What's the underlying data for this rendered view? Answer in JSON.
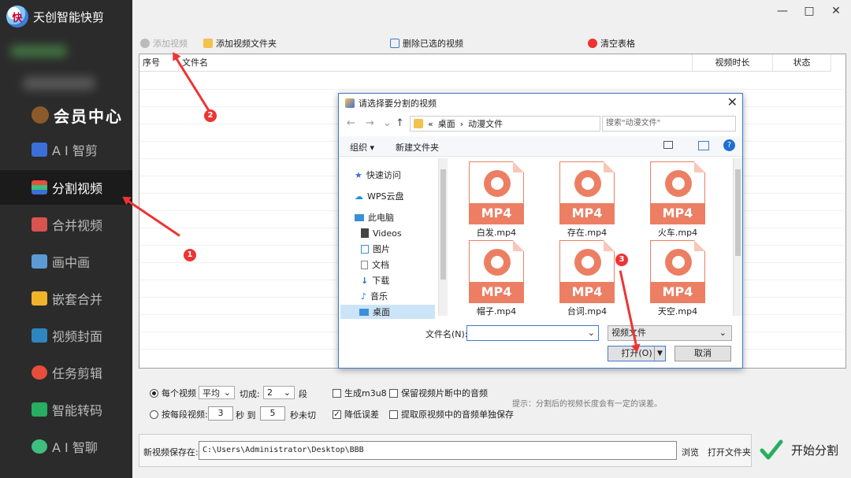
{
  "app": {
    "title": "天创智能快剪",
    "logo_text": "快"
  },
  "window": {
    "minimize": "—",
    "maximize": "□",
    "close": "✕"
  },
  "sidebar": {
    "member": "会员中心",
    "items": [
      {
        "label": "A I 智剪",
        "color": "#3b6fd8"
      },
      {
        "label": "分割视频",
        "color": "#e94d3b",
        "active": true
      },
      {
        "label": "合并视频",
        "color": "#d9534f"
      },
      {
        "label": "画中画",
        "color": "#5b9bd5"
      },
      {
        "label": "嵌套合并",
        "color": "#f0b429"
      },
      {
        "label": "视频封面",
        "color": "#2e86c1"
      },
      {
        "label": "任务剪辑",
        "color": "#e74c3c"
      },
      {
        "label": "智能转码",
        "color": "#27ae60"
      },
      {
        "label": "A I 智聊",
        "color": "#3fbf7f"
      }
    ]
  },
  "toolbar": {
    "add_video": "添加视频",
    "add_folder": "添加视频文件夹",
    "delete_selected": "删除已选的视频",
    "clear_table": "清空表格"
  },
  "table": {
    "columns": [
      "序号",
      "文件名",
      "视频时长",
      "状态"
    ]
  },
  "options": {
    "per_video": "每个视频",
    "mode": "平均",
    "cut_label": "切成:",
    "segments": "2",
    "segment_unit": "段",
    "gen_m3u8": "生成m3u8",
    "keep_audio": "保留视频片断中的音频",
    "by_seconds": "按每段视频:",
    "sec_from": "3",
    "sec_to_label": "秒  到",
    "sec_to": "5",
    "sec_suffix": "秒未切",
    "reduce_error": "降低误差",
    "extract_audio": "提取原视频中的音频单独保存",
    "hint": "提示：分割后的视频长度会有一定的误差。",
    "gen_m3u8_checked": false,
    "keep_audio_checked": false,
    "reduce_error_checked": true,
    "extract_audio_checked": false
  },
  "save": {
    "label": "新视频保存在:",
    "path": "C:\\Users\\Administrator\\Desktop\\BBB",
    "browse": "浏览",
    "open_folder": "打开文件夹",
    "start": "开始分割"
  },
  "dialog": {
    "title": "请选择要分割的视频",
    "close": "✕",
    "breadcrumb_prefix": "«",
    "breadcrumb_1": "桌面",
    "breadcrumb_sep": "›",
    "breadcrumb_2": "动漫文件",
    "search_placeholder": "搜索\"动漫文件\"",
    "organize": "组织 ▾",
    "new_folder": "新建文件夹",
    "tree": [
      {
        "label": "快速访问",
        "icon": "star-icon"
      },
      {
        "label": "WPS云盘",
        "icon": "cloud-icon"
      },
      {
        "label": "此电脑",
        "icon": "computer-icon"
      },
      {
        "label": "Videos",
        "icon": "video-folder-icon"
      },
      {
        "label": "图片",
        "icon": "picture-icon"
      },
      {
        "label": "文档",
        "icon": "document-icon"
      },
      {
        "label": "下载",
        "icon": "download-icon"
      },
      {
        "label": "音乐",
        "icon": "music-icon"
      },
      {
        "label": "桌面",
        "icon": "desktop-icon"
      }
    ],
    "files": [
      {
        "name": "白发.mp4",
        "badge": "MP4"
      },
      {
        "name": "存在.mp4",
        "badge": "MP4"
      },
      {
        "name": "火车.mp4",
        "badge": "MP4"
      },
      {
        "name": "帽子.mp4",
        "badge": "MP4"
      },
      {
        "name": "台词.mp4",
        "badge": "MP4"
      },
      {
        "name": "天空.mp4",
        "badge": "MP4"
      }
    ],
    "filename_label": "文件名(N):",
    "filetype": "视频文件",
    "open": "打开(O)",
    "cancel": "取消"
  },
  "annotations": {
    "one": "1",
    "two": "2",
    "three": "3"
  }
}
